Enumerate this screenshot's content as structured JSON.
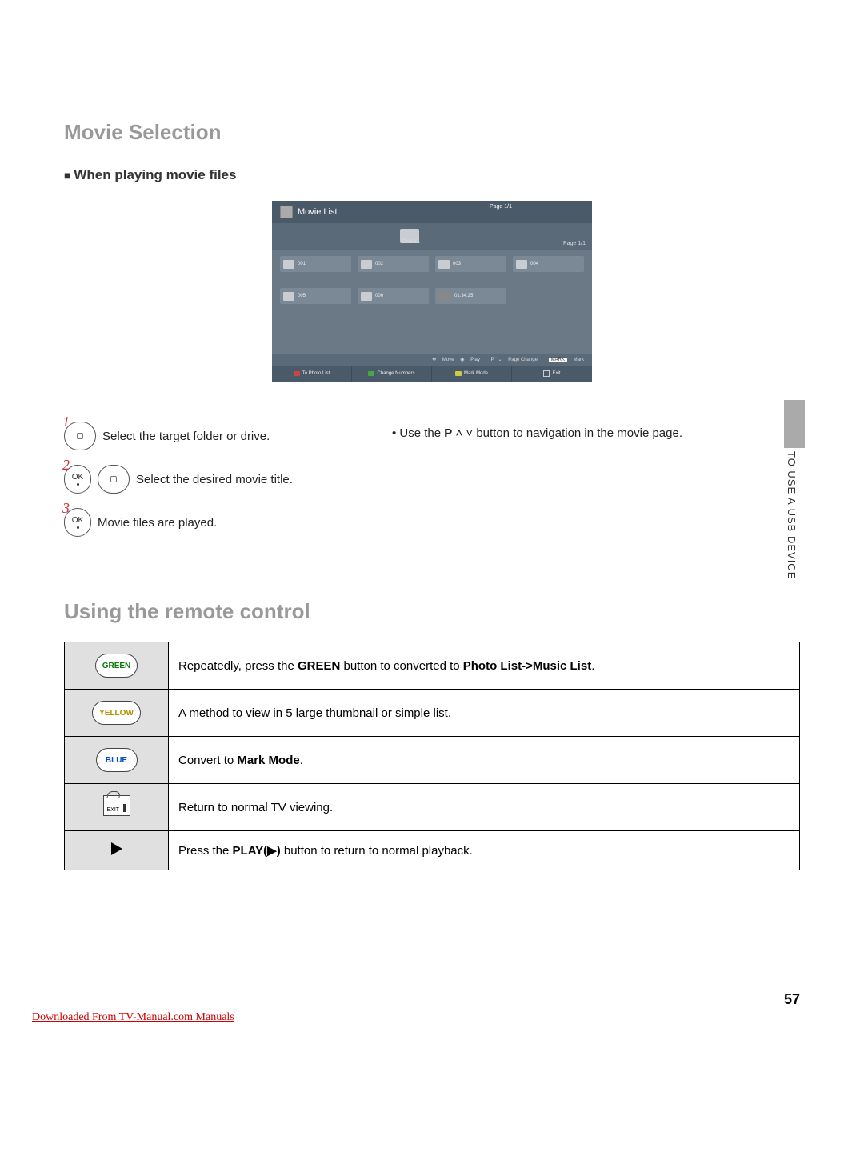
{
  "section_title": "Movie Selection",
  "subsection_title": "When playing movie files",
  "screen": {
    "title": "Movie List",
    "page_top": "Page 1/1",
    "drive": "Drive1",
    "page_sub": "Page 1/1",
    "items": [
      "001",
      "002",
      "003",
      "004",
      "005",
      "006"
    ],
    "movie_meta": "01:34:25",
    "hints": {
      "move": "Move",
      "play": "Play",
      "page_change": "Page Change",
      "mark_badge": "MARK",
      "mark": "Mark",
      "p": "P"
    },
    "bottom": {
      "to_photo": "To Photo List",
      "change_numbers": "Change Numbers",
      "mark_mode": "Mark Mode",
      "exit": "Exit"
    }
  },
  "steps": [
    {
      "n": "1",
      "text": "Select the target folder or drive."
    },
    {
      "n": "2",
      "text": "Select the desired movie title."
    },
    {
      "n": "3",
      "text": "Movie files are played."
    }
  ],
  "note_prefix": "• Use the ",
  "note_bold": "P",
  "note_suffix": " button to navigation in the movie page.",
  "note_arrows": " ꞈ ˅",
  "side_tab": "TO USE A USB DEVICE",
  "section2_title": "Using the remote control",
  "btn_ok": "OK",
  "remote": {
    "green_label": "GREEN",
    "green_pre": "Repeatedly, press the ",
    "green_b1": "GREEN",
    "green_mid": " button to converted to ",
    "green_b2": "Photo List->Music List",
    "green_post": ".",
    "yellow_label": "YELLOW",
    "yellow_text": "A method to view in 5 large thumbnail or simple list.",
    "blue_label": "BLUE",
    "blue_pre": "Convert to ",
    "blue_b": "Mark Mode",
    "blue_post": ".",
    "exit_label": "EXIT",
    "exit_text": "Return to normal TV viewing.",
    "play_pre": "Press the ",
    "play_b": "PLAY(▶)",
    "play_post": " button to return to normal playback."
  },
  "page_number": "57",
  "download_link": "Downloaded From TV-Manual.com Manuals"
}
